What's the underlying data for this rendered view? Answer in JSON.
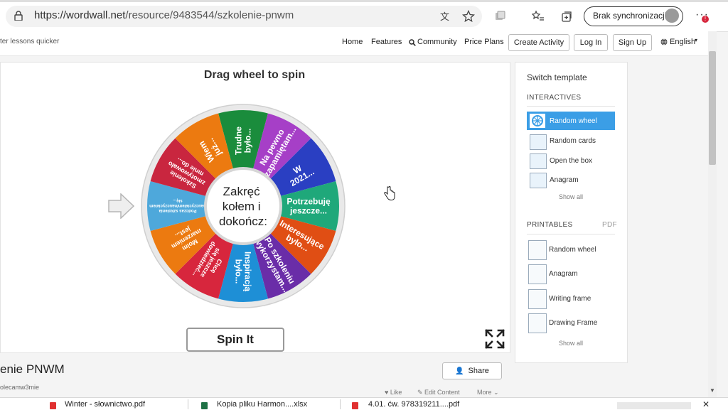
{
  "browser": {
    "url_host": "https://wordwall.net",
    "url_path": "/resource/9483544/szkolenie-pnwm",
    "sync_label": "Brak synchronizacji",
    "badge": "!"
  },
  "header": {
    "tagline": "ter lessons quicker",
    "nav": [
      "Home",
      "Features",
      "Community",
      "Price Plans"
    ],
    "create_label": "Create Activity",
    "login_label": "Log In",
    "signup_label": "Sign Up",
    "language_label": "English"
  },
  "activity": {
    "instruction": "Drag wheel to spin",
    "center_lines": [
      "Zakręć",
      "kołem i",
      "dokończ:"
    ],
    "spin_label": "Spin It",
    "segments": [
      {
        "lines": [
          "Trudne",
          "było..."
        ],
        "color": "#1a8c3c"
      },
      {
        "lines": [
          "Na pewno",
          "zapamiętam..."
        ],
        "color": "#a63fc7"
      },
      {
        "lines": [
          "W",
          "2021..."
        ],
        "color": "#2a3fc2"
      },
      {
        "lines": [
          "Potrzebuję",
          "jeszcze..."
        ],
        "color": "#1fa87a"
      },
      {
        "lines": [
          "Interesujące",
          "było..."
        ],
        "color": "#e04e14"
      },
      {
        "lines": [
          "Po szkoleniu",
          "wykorzystam..."
        ],
        "color": "#6a2da8"
      },
      {
        "lines": [
          "Inspiracją",
          "było..."
        ],
        "color": "#1e8fd6"
      },
      {
        "lines": [
          "Chcę",
          "się jeszcze",
          "dowiedzieć..."
        ],
        "color": "#d7263d"
      },
      {
        "lines": [
          "Moim",
          "marzeniem",
          "jest..."
        ],
        "color": "#ec7a10"
      },
      {
        "lines": [
          "Podczas szkolenia",
          "nauczycielem/nauczycielem",
          "się..."
        ],
        "color": "#4ea8db"
      },
      {
        "lines": [
          "Szkolenie",
          "zmotywowało",
          "mnie do..."
        ],
        "color": "#c9263f"
      },
      {
        "lines": [
          "Wiem",
          "już..."
        ],
        "color": "#ec7a10"
      }
    ]
  },
  "details": {
    "title": "enie PNWM",
    "author": "olecamw3mie",
    "share_label": "Share",
    "like_label": "Like",
    "edit_label": "Edit Content",
    "more_label": "More"
  },
  "sidebar": {
    "switch_label": "Switch template",
    "interactives_label": "INTERACTIVES",
    "interactives": [
      "Random wheel",
      "Random cards",
      "Open the box",
      "Anagram"
    ],
    "show_all": "Show all",
    "printables_label": "PRINTABLES",
    "pdf_label": "PDF",
    "printables": [
      "Random wheel",
      "Anagram",
      "Writing frame",
      "Drawing Frame"
    ],
    "show_all_2": "Show all"
  },
  "downloads": [
    "Winter - słownictwo.pdf",
    "Kopia pliku Harmon....xlsx",
    "4.01. ćw. 978319211....pdf"
  ]
}
